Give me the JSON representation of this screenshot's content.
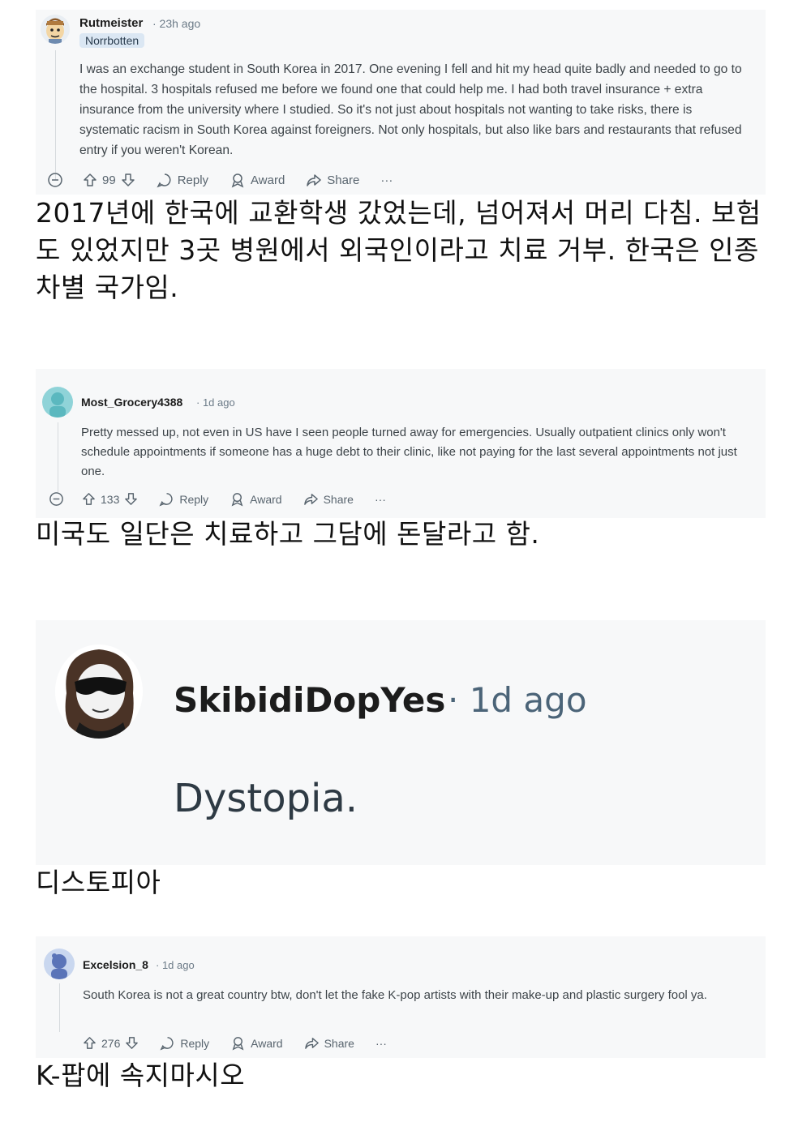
{
  "comments": [
    {
      "username": "Rutmeister",
      "time": "· 23h ago",
      "flair": "Norrbotten",
      "body": "I was an exchange student in South Korea in 2017. One evening I fell and hit my head quite badly and needed to go to the hospital. 3 hospitals refused me before we found one that could help me. I had both travel insurance + extra insurance from the university where I studied. So it's not just about hospitals not wanting to take risks, there is systematic racism in South Korea against foreigners. Not only hospitals, but also like bars and restaurants that refused entry if you weren't Korean.",
      "votes": "99",
      "reply_label": "Reply",
      "award_label": "Award",
      "share_label": "Share",
      "more_label": "···",
      "caption": "2017년에 한국에 교환학생 갔었는데, 넘어져서 머리 다침. 보험도 있었지만 3곳 병원에서 외국인이라고 치료 거부. 한국은 인종차별 국가임."
    },
    {
      "username": "Most_Grocery4388",
      "time": "· 1d ago",
      "body": "Pretty messed up, not even in US have I seen people turned away for emergencies. Usually outpatient clinics only won't schedule appointments if someone has a huge debt to their clinic, like not paying for the last several appointments not just one.",
      "votes": "133",
      "reply_label": "Reply",
      "award_label": "Award",
      "share_label": "Share",
      "more_label": "···",
      "caption": "미국도 일단은 치료하고 그담에 돈달라고 함."
    },
    {
      "username": "SkibidiDopYes",
      "time": "· 1d ago",
      "body": "Dystopia.",
      "caption": "디스토피아"
    },
    {
      "username": "Excelsion_8",
      "time": "· 1d ago",
      "body": "South Korea is not a great country btw, don't let the fake K-pop artists with their make-up and plastic surgery fool ya.",
      "votes": "276",
      "reply_label": "Reply",
      "award_label": "Award",
      "share_label": "Share",
      "more_label": "···",
      "caption": "K-팝에 속지마시오"
    }
  ],
  "colors": {
    "card_bg": "#f7f8f9",
    "meta_text": "#6b7a87",
    "flair_bg": "#dbe7f3"
  },
  "icons": [
    "collapse-icon",
    "upvote-icon",
    "downvote-icon",
    "reply-icon",
    "award-icon",
    "share-icon",
    "more-icon"
  ]
}
